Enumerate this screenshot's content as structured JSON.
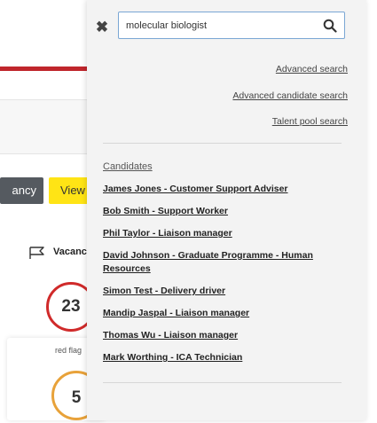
{
  "background": {
    "buttons": {
      "vacancy_label": "ancy",
      "view_label": "View"
    },
    "vacancy_heading": "Vacanc",
    "cards": [
      {
        "count": "23",
        "label": "red flag",
        "color": "#d02a2a"
      },
      {
        "count": "5",
        "color": "#e8a23a"
      }
    ],
    "colors": {
      "accent_red": "#c0262c",
      "highlight_yellow": "#ffe415"
    }
  },
  "search": {
    "query": "molecular biologist",
    "close_icon": "close-icon",
    "submit_icon": "search-icon",
    "links": {
      "advanced": "Advanced search",
      "advanced_candidate": "Advanced candidate search",
      "talent_pool": "Talent pool search"
    },
    "section_title": "Candidates",
    "candidates": [
      "James Jones - Customer Support Adviser",
      "Bob Smith - Support Worker",
      "Phil Taylor - Liaison manager",
      "David Johnson - Graduate Programme - Human Resources",
      "Simon Test - Delivery driver",
      "Mandip Jaspal - Liaison manager",
      "Thomas Wu - Liaison manager",
      "Mark Worthing - ICA Technician"
    ]
  }
}
